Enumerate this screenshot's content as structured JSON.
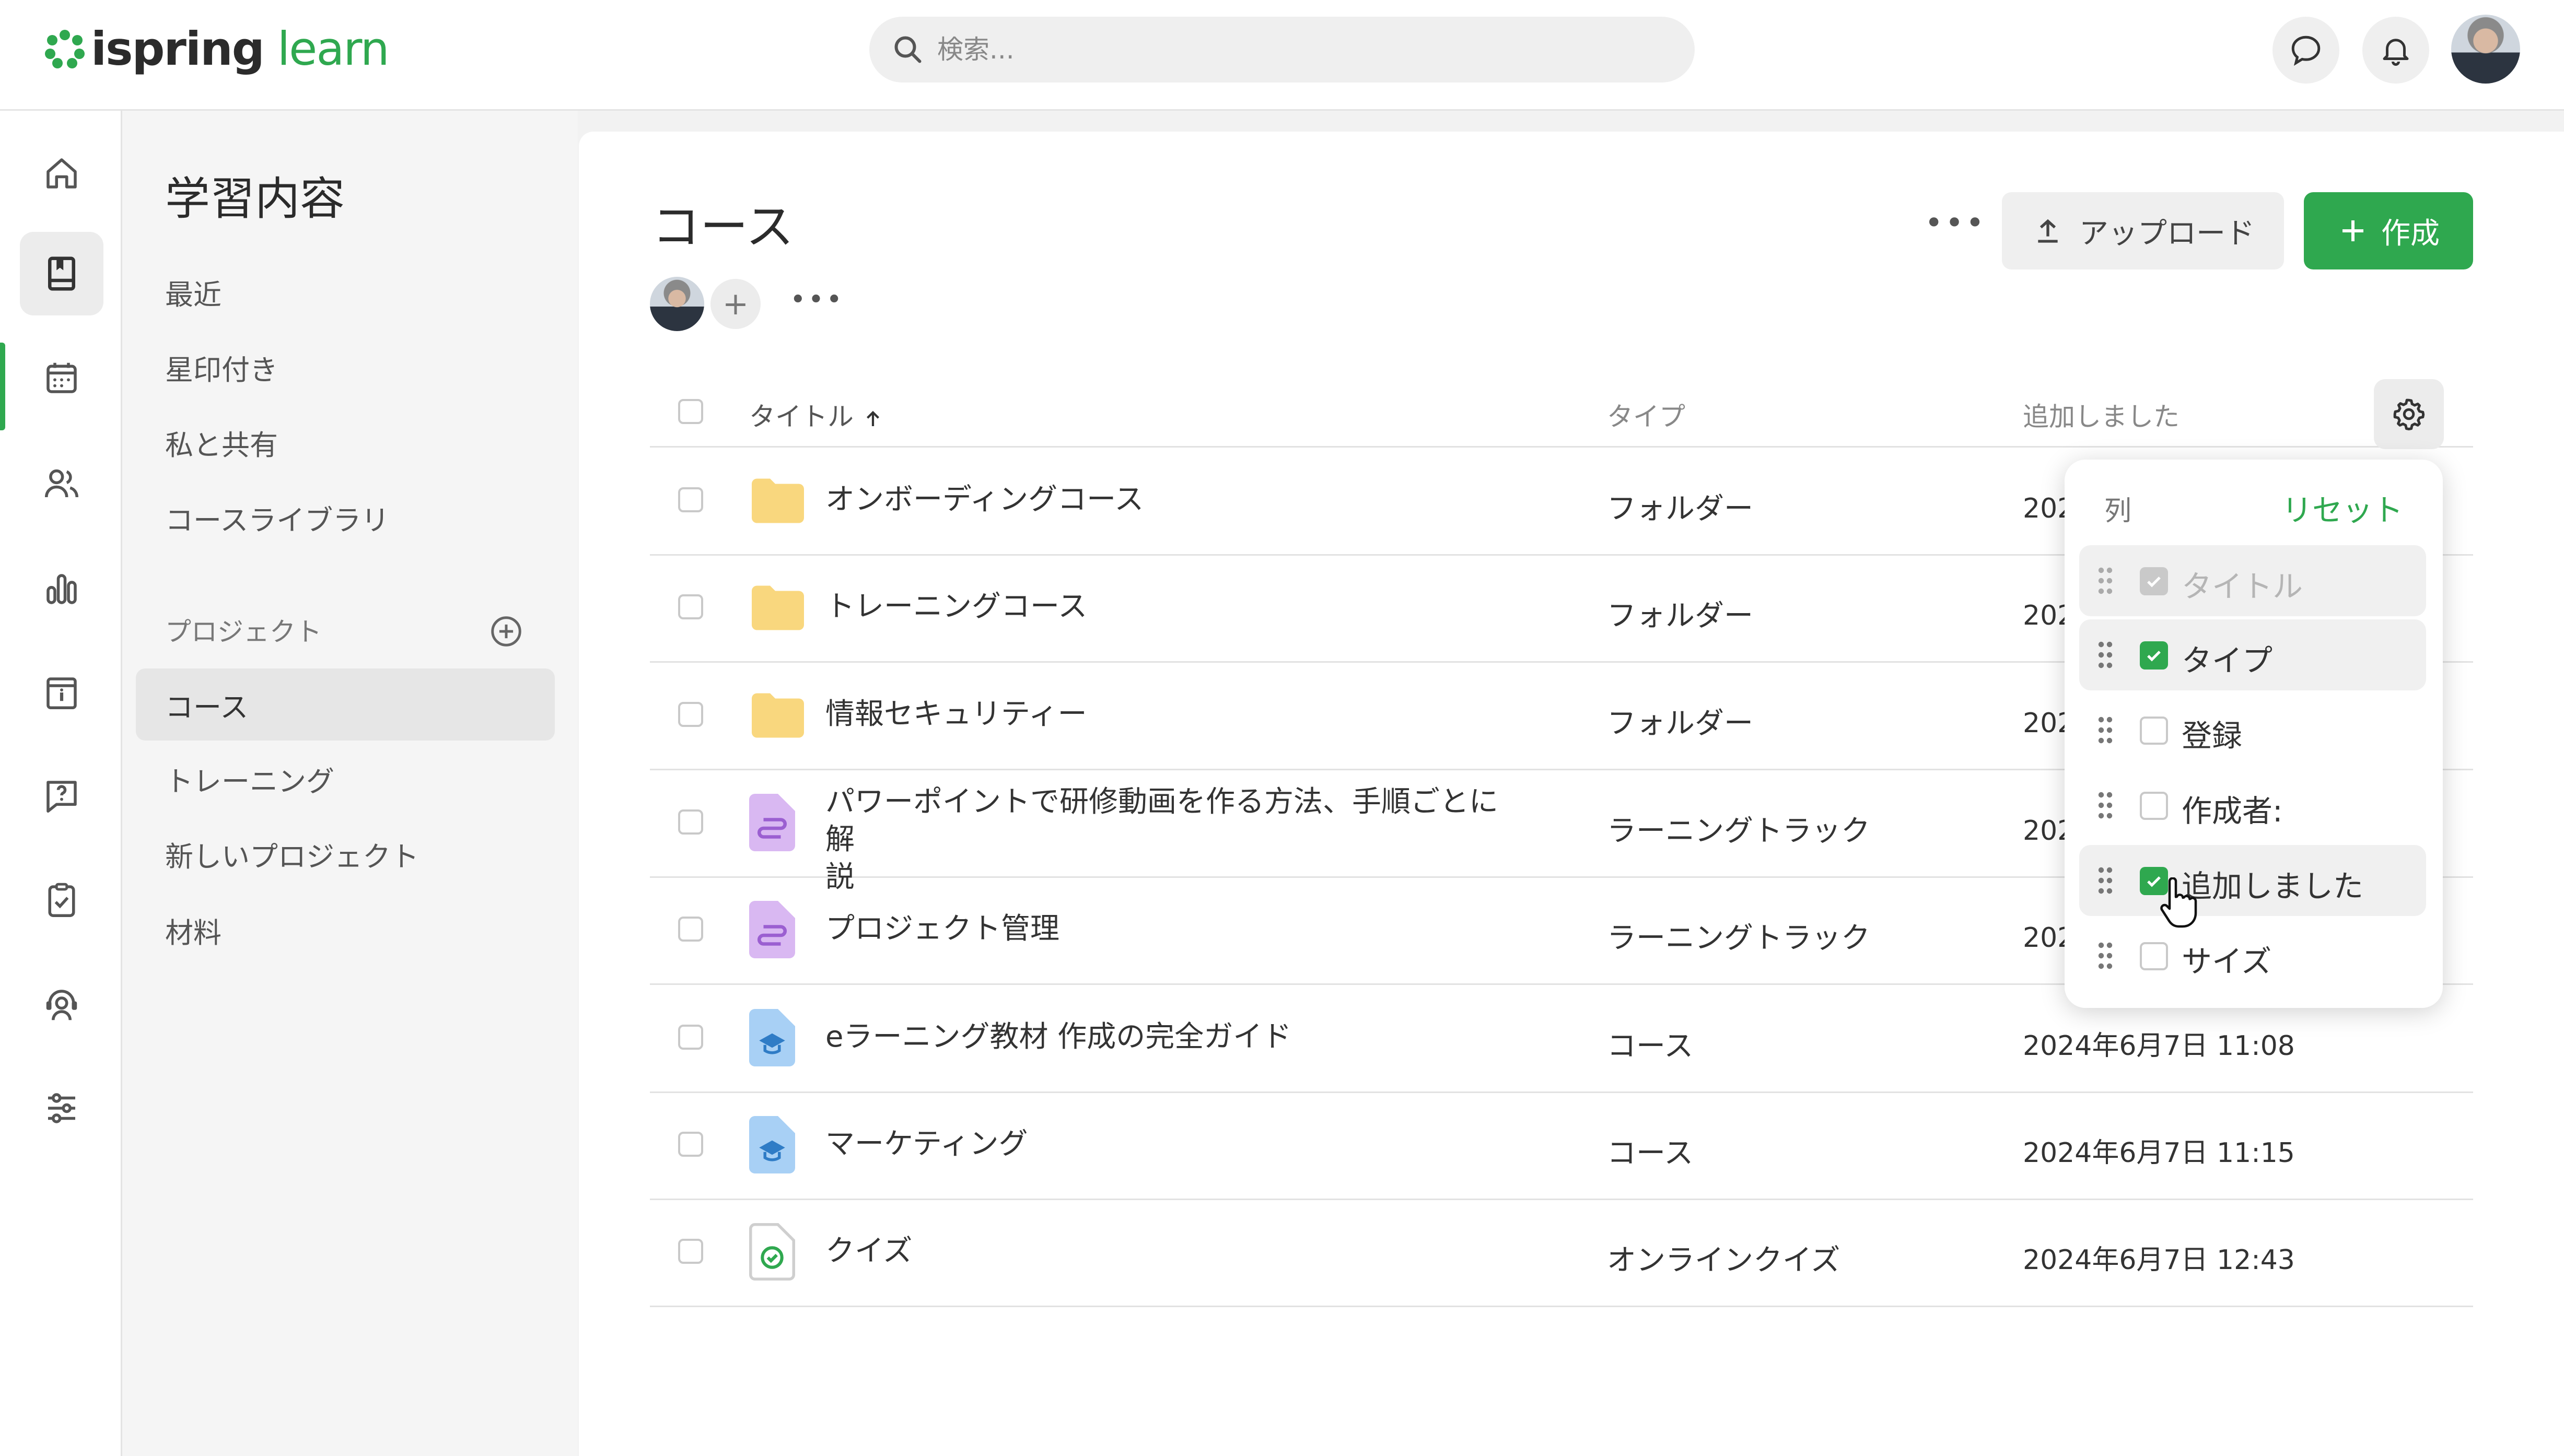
{
  "brand": {
    "name_part1": "ispring",
    "name_part2": "learn",
    "accent": "#2fa84f"
  },
  "search": {
    "placeholder": "検索..."
  },
  "rail": [
    "home-icon",
    "book-icon",
    "calendar-icon",
    "users-icon",
    "chart-icon",
    "info-board-icon",
    "question-icon",
    "clipboard-check-icon",
    "support-icon",
    "sliders-icon"
  ],
  "subnav": {
    "title": "学習内容",
    "links": [
      "最近",
      "星印付き",
      "私と共有",
      "コースライブラリ"
    ],
    "projects_label": "プロジェクト",
    "projects": [
      "コース",
      "トレーニング",
      "新しいプロジェクト",
      "材料"
    ]
  },
  "main": {
    "title": "コース",
    "upload_label": "アップロード",
    "create_label": "作成",
    "columns": {
      "title": "タイトル",
      "type": "タイプ",
      "added": "追加しました"
    },
    "rows": [
      {
        "name": "オンボーディングコース",
        "type": "フォルダー",
        "added": "2024年6",
        "icon": "folder-icon"
      },
      {
        "name": "トレーニングコース",
        "type": "フォルダー",
        "added": "2024年6",
        "icon": "folder-icon"
      },
      {
        "name": "情報セキュリティー",
        "type": "フォルダー",
        "added": "2024年6",
        "icon": "folder-icon"
      },
      {
        "name": "パワーポイントで研修動画を作る方法、手順ごとに解",
        "name2": "説",
        "type": "ラーニングトラック",
        "added": "2024年6",
        "icon": "learning-track-icon"
      },
      {
        "name": "プロジェクト管理",
        "type": "ラーニングトラック",
        "added": "2024年6",
        "icon": "learning-track-icon"
      },
      {
        "name": "eラーニング教材 作成の完全ガイド",
        "type": "コース",
        "added": "2024年6月7日 11:08",
        "icon": "course-icon"
      },
      {
        "name": "マーケティング",
        "type": "コース",
        "added": "2024年6月7日 11:15",
        "icon": "course-icon"
      },
      {
        "name": "クイズ",
        "type": "オンラインクイズ",
        "added": "2024年6月7日 12:43",
        "icon": "quiz-icon"
      }
    ]
  },
  "columns_popup": {
    "heading": "列",
    "reset": "リセット",
    "items": [
      {
        "label": "タイトル",
        "state": "disabled-checked"
      },
      {
        "label": "タイプ",
        "state": "checked"
      },
      {
        "label": "登録",
        "state": "unchecked"
      },
      {
        "label": "作成者:",
        "state": "unchecked"
      },
      {
        "label": "追加しました",
        "state": "checked"
      },
      {
        "label": "サイズ",
        "state": "unchecked"
      }
    ]
  }
}
